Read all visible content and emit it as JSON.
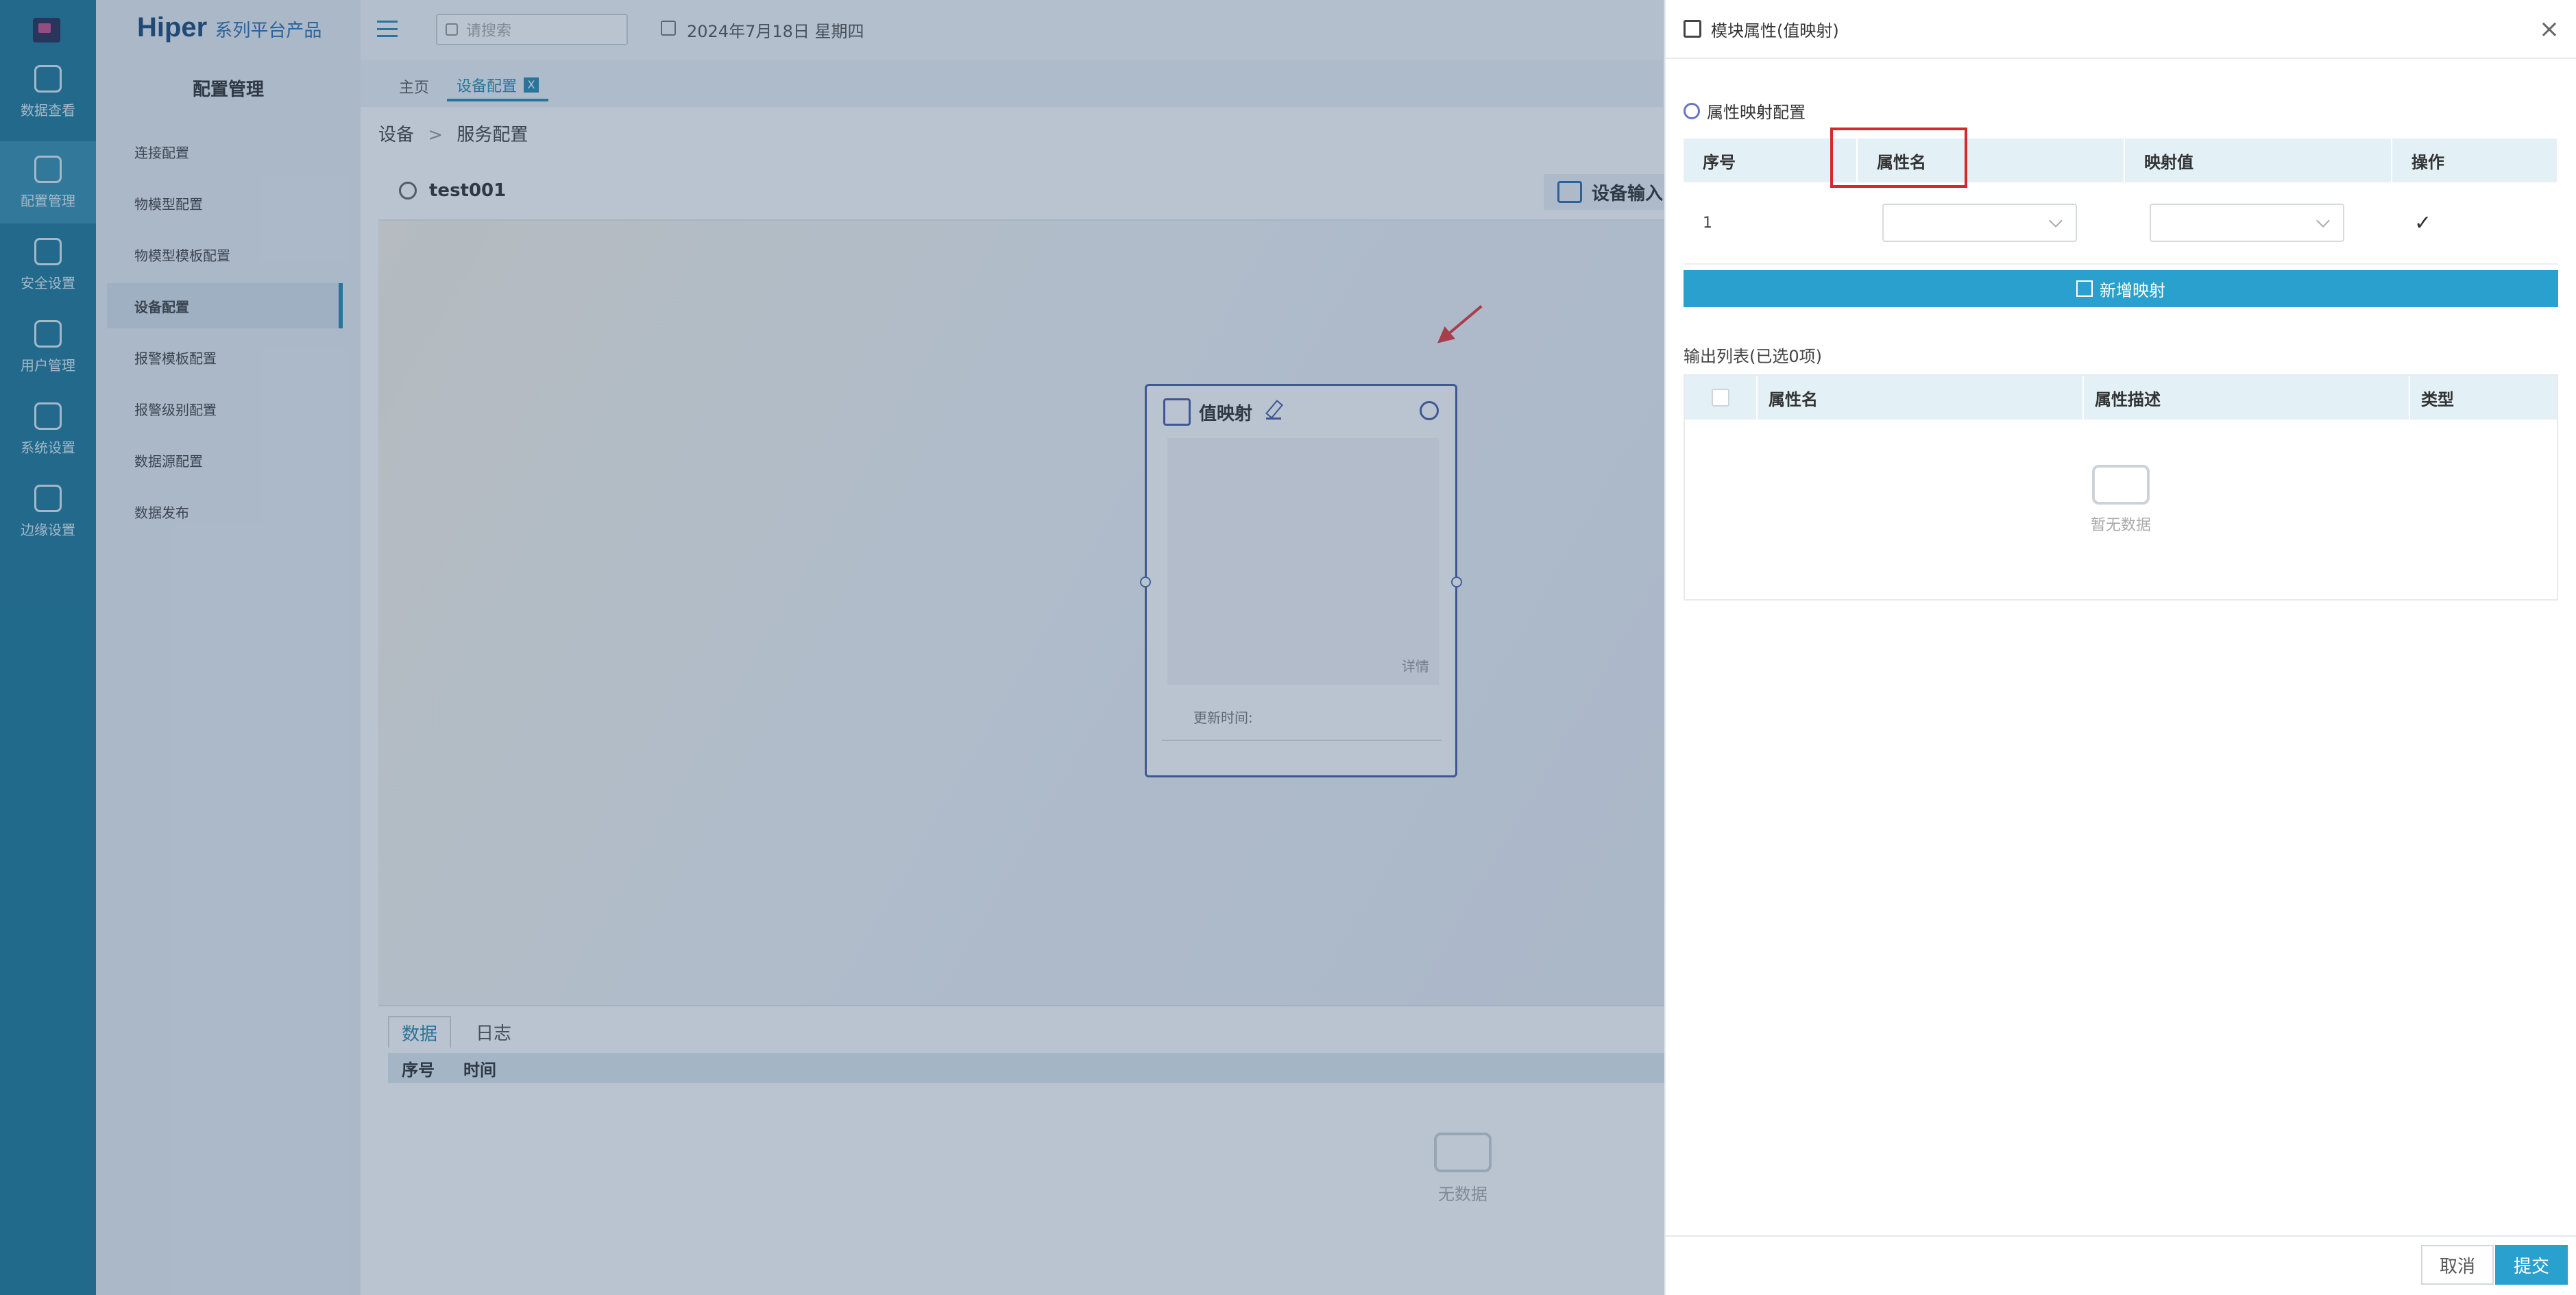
{
  "app": {
    "brand": "Hiper",
    "brand_sub": "系列平台产品",
    "search_placeholder": "请搜索",
    "date": "2024年7月18日 星期四"
  },
  "rail": [
    {
      "label": "数据查看",
      "icon": "cube-icon"
    },
    {
      "label": "配置管理",
      "icon": "config-icon",
      "active": true
    },
    {
      "label": "安全设置",
      "icon": "home-lock-icon"
    },
    {
      "label": "用户管理",
      "icon": "user-shield-icon"
    },
    {
      "label": "系统设置",
      "icon": "system-icon"
    },
    {
      "label": "边缘设置",
      "icon": "edge-icon"
    }
  ],
  "submenu": {
    "title": "配置管理",
    "items": [
      "连接配置",
      "物模型配置",
      "物模型模板配置",
      "设备配置",
      "报警模板配置",
      "报警级别配置",
      "数据源配置",
      "数据发布"
    ],
    "active_index": 3
  },
  "tabs": [
    {
      "label": "主页"
    },
    {
      "label": "设备配置",
      "active": true,
      "close": "X"
    }
  ],
  "breadcrumb": {
    "root": "设备",
    "sep": ">",
    "current": "服务配置"
  },
  "main": {
    "title": "test001",
    "device_input": "设备输入"
  },
  "node": {
    "title": "值映射",
    "detail": "详情",
    "update_label": "更新时间:"
  },
  "bottom": {
    "tabs": [
      "数据",
      "日志"
    ],
    "cols": [
      "序号",
      "时间"
    ],
    "empty": "无数据"
  },
  "drawer": {
    "title": "模块属性(值映射)",
    "close": "×",
    "section_title": "属性映射配置",
    "map_cols": [
      "序号",
      "属性名",
      "映射值",
      "操作"
    ],
    "rows": [
      {
        "index": "1",
        "action": "✓"
      }
    ],
    "add_button": "新增映射",
    "output_title": "输出列表(已选0项)",
    "output_cols": [
      "属性名",
      "属性描述",
      "类型"
    ],
    "output_empty": "暂无数据",
    "cancel": "取消",
    "submit": "提交"
  },
  "colors": {
    "accent": "#2aa0cf",
    "rail": "#1f7a9a",
    "highlight": "#d9272e"
  }
}
